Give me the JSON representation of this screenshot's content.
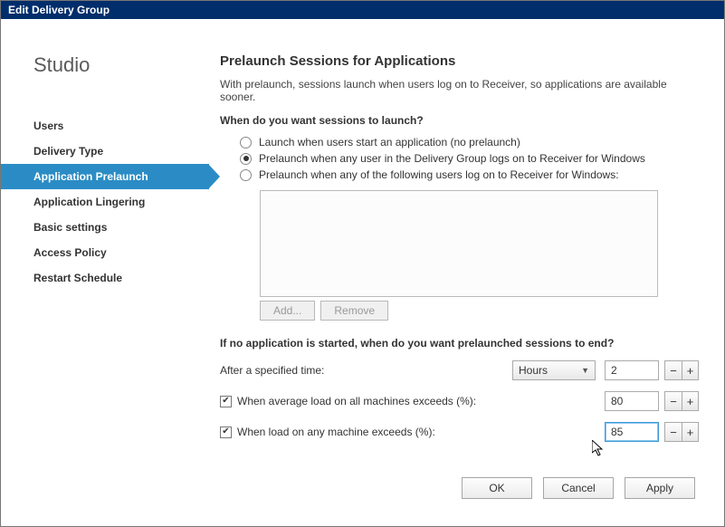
{
  "window": {
    "title": "Edit Delivery Group"
  },
  "studio_label": "Studio",
  "sidebar": {
    "items": [
      {
        "label": "Users"
      },
      {
        "label": "Delivery Type"
      },
      {
        "label": "Application Prelaunch"
      },
      {
        "label": "Application Lingering"
      },
      {
        "label": "Basic settings"
      },
      {
        "label": "Access Policy"
      },
      {
        "label": "Restart Schedule"
      }
    ],
    "selected_index": 2
  },
  "main": {
    "heading": "Prelaunch Sessions for Applications",
    "intro": "With prelaunch, sessions launch when users log on to Receiver, so applications are available sooner.",
    "launch_question": "When do you want sessions to launch?",
    "radios": {
      "option_none": "Launch when users start an application (no prelaunch)",
      "option_any": "Prelaunch when any user in the Delivery Group logs on to Receiver for Windows",
      "option_specific": "Prelaunch when any of the following users log on to Receiver for Windows:",
      "selected": "any"
    },
    "list_buttons": {
      "add": "Add...",
      "remove": "Remove"
    },
    "end_question": "If no application is started, when do you want prelaunched sessions to end?",
    "after_time": {
      "label": "After a specified time:",
      "unit": "Hours",
      "value": "2"
    },
    "avg_load": {
      "label": "When average load on all machines exceeds (%):",
      "checked": true,
      "value": "80"
    },
    "any_load": {
      "label": "When load on any machine exceeds (%):",
      "checked": true,
      "value": "85"
    }
  },
  "dialog_buttons": {
    "ok": "OK",
    "cancel": "Cancel",
    "apply": "Apply"
  }
}
